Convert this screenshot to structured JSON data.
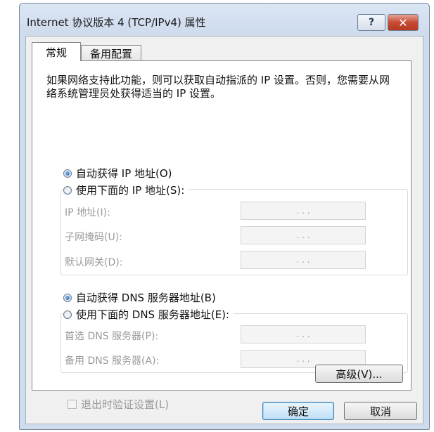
{
  "window": {
    "title": "Internet 协议版本 4 (TCP/IPv4) 属性",
    "help_label": "?",
    "close_label": "✕"
  },
  "tabs": [
    {
      "label": "常规",
      "selected": true
    },
    {
      "label": "备用配置",
      "selected": false
    }
  ],
  "description": "如果网络支持此功能，则可以获取自动指派的 IP 设置。否则，您需要从网络系统管理员处获得适当的 IP 设置。",
  "ip": {
    "auto_label": "自动获得 IP 地址(O)",
    "auto_selected": true,
    "manual_label": "使用下面的 IP 地址(S):",
    "manual_selected": false,
    "fields": [
      {
        "label": "IP 地址(I):",
        "value": ". . ."
      },
      {
        "label": "子网掩码(U):",
        "value": ". . ."
      },
      {
        "label": "默认网关(D):",
        "value": ". . ."
      }
    ]
  },
  "dns": {
    "auto_label": "自动获得 DNS 服务器地址(B)",
    "auto_selected": true,
    "manual_label": "使用下面的 DNS 服务器地址(E):",
    "manual_selected": false,
    "fields": [
      {
        "label": "首选 DNS 服务器(P):",
        "value": ". . ."
      },
      {
        "label": "备用 DNS 服务器(A):",
        "value": ". . ."
      }
    ]
  },
  "validate_label": "退出时验证设置(L)",
  "validate_checked": false,
  "advanced_label": "高级(V)...",
  "ok_label": "确定",
  "cancel_label": "取消",
  "colors": {
    "close_button": "#c74a33",
    "default_button_border": "#3c7fb1",
    "disabled_text": "#9a9a9a"
  }
}
